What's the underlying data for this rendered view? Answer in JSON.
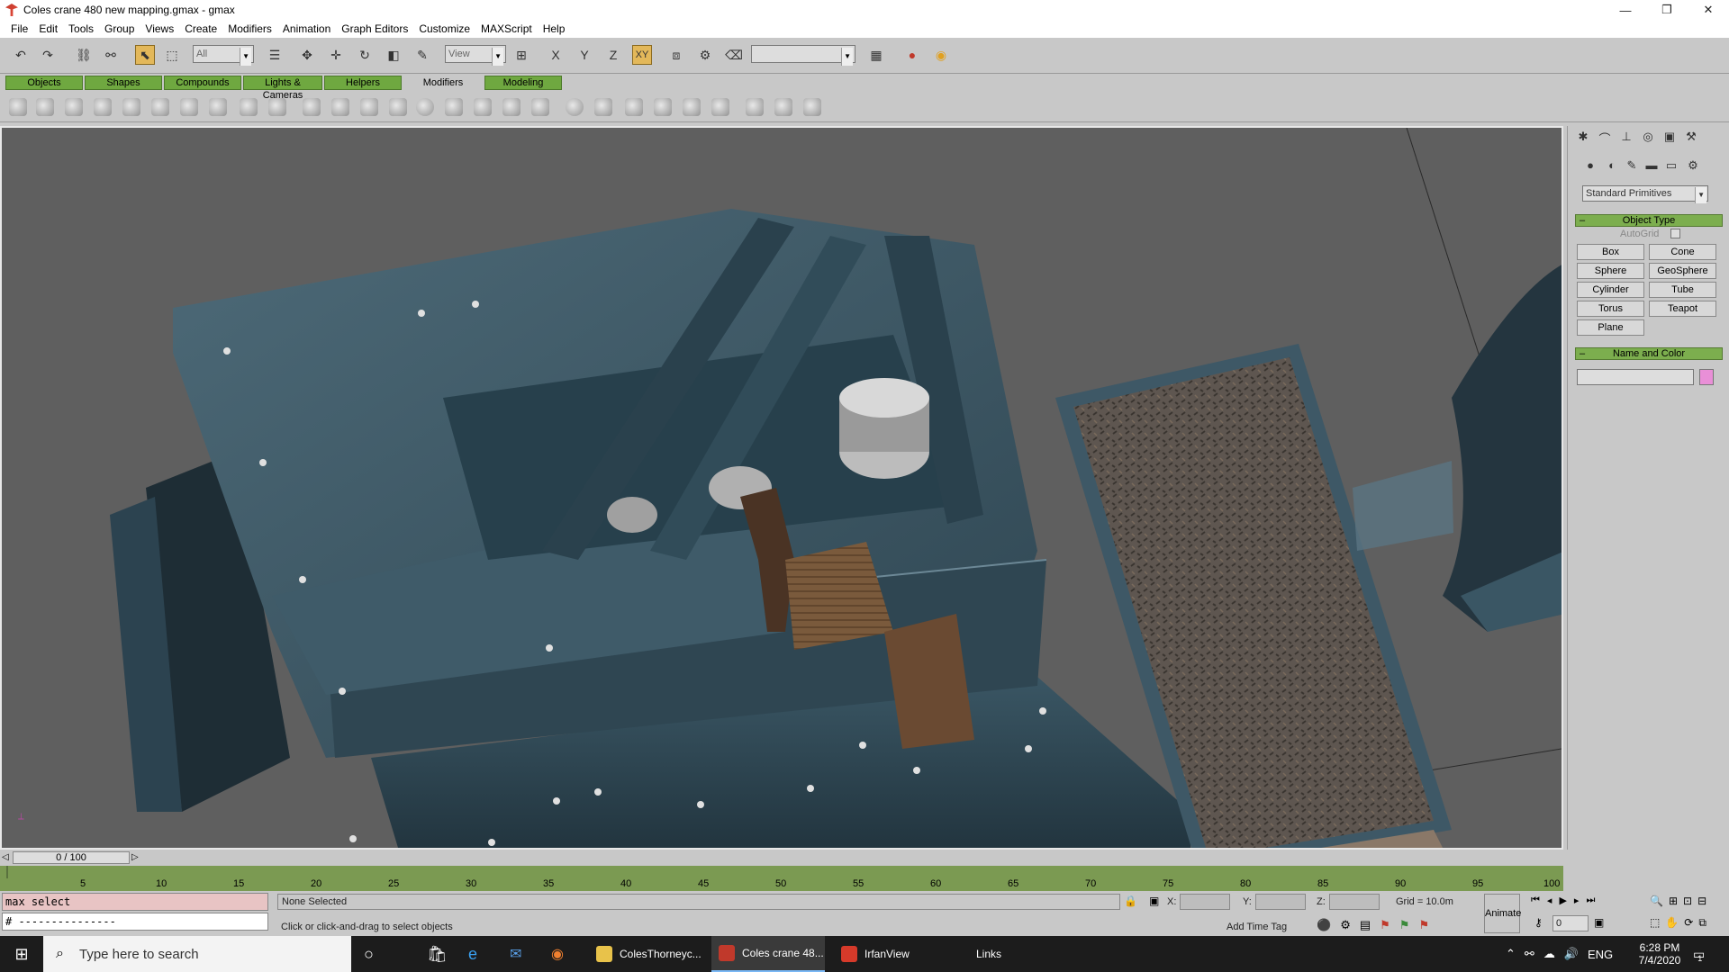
{
  "window": {
    "title": "Coles crane 480 new mapping.gmax - gmax",
    "controls": [
      "—",
      "❐",
      "✕"
    ]
  },
  "menubar": [
    "File",
    "Edit",
    "Tools",
    "Group",
    "Views",
    "Create",
    "Modifiers",
    "Animation",
    "Graph Editors",
    "Customize",
    "MAXScript",
    "Help"
  ],
  "toolbar": {
    "selection_filter": "All",
    "reference_coord": "View",
    "axis_x": "X",
    "axis_y": "Y",
    "axis_z": "Z",
    "axis_xy": "XY",
    "named_selection": ""
  },
  "tabs": [
    "Objects",
    "Shapes",
    "Compounds",
    "Lights & Cameras",
    "Helpers",
    "Modifiers",
    "Modeling"
  ],
  "active_tab": "Modifiers",
  "command_panel": {
    "category": "Standard Primitives",
    "object_type_title": "Object Type",
    "autogrid_label": "AutoGrid",
    "buttons": [
      "Box",
      "Cone",
      "Sphere",
      "GeoSphere",
      "Cylinder",
      "Tube",
      "Torus",
      "Teapot",
      "Plane"
    ],
    "name_color_title": "Name and Color",
    "name_value": "",
    "color": "#e98fd7"
  },
  "timeline": {
    "frame_label": "0 / 100",
    "ticks": [
      "5",
      "10",
      "15",
      "20",
      "25",
      "30",
      "35",
      "40",
      "45",
      "50",
      "55",
      "60",
      "65",
      "70",
      "75",
      "80",
      "85",
      "90",
      "95",
      "100"
    ]
  },
  "status": {
    "listener_line1": "max select",
    "listener_line2": "# ---------------",
    "selection": "None Selected",
    "prompt": "Click or click-and-drag to select objects",
    "x_label": "X:",
    "y_label": "Y:",
    "z_label": "Z:",
    "grid": "Grid = 10.0m",
    "add_time_tag": "Add Time Tag",
    "animate": "Animate",
    "frame_value": "0"
  },
  "taskbar": {
    "search_placeholder": "Type here to search",
    "apps": [
      {
        "label": "ColesThorneyc...",
        "color": "#e8c24a"
      },
      {
        "label": "Coles crane 48...",
        "color": "#c0392b"
      },
      {
        "label": "IrfanView",
        "color": "#d63a2a"
      }
    ],
    "links": "Links",
    "lang": "ENG",
    "time": "6:28 PM",
    "date": "7/4/2020",
    "notifications": "1"
  }
}
